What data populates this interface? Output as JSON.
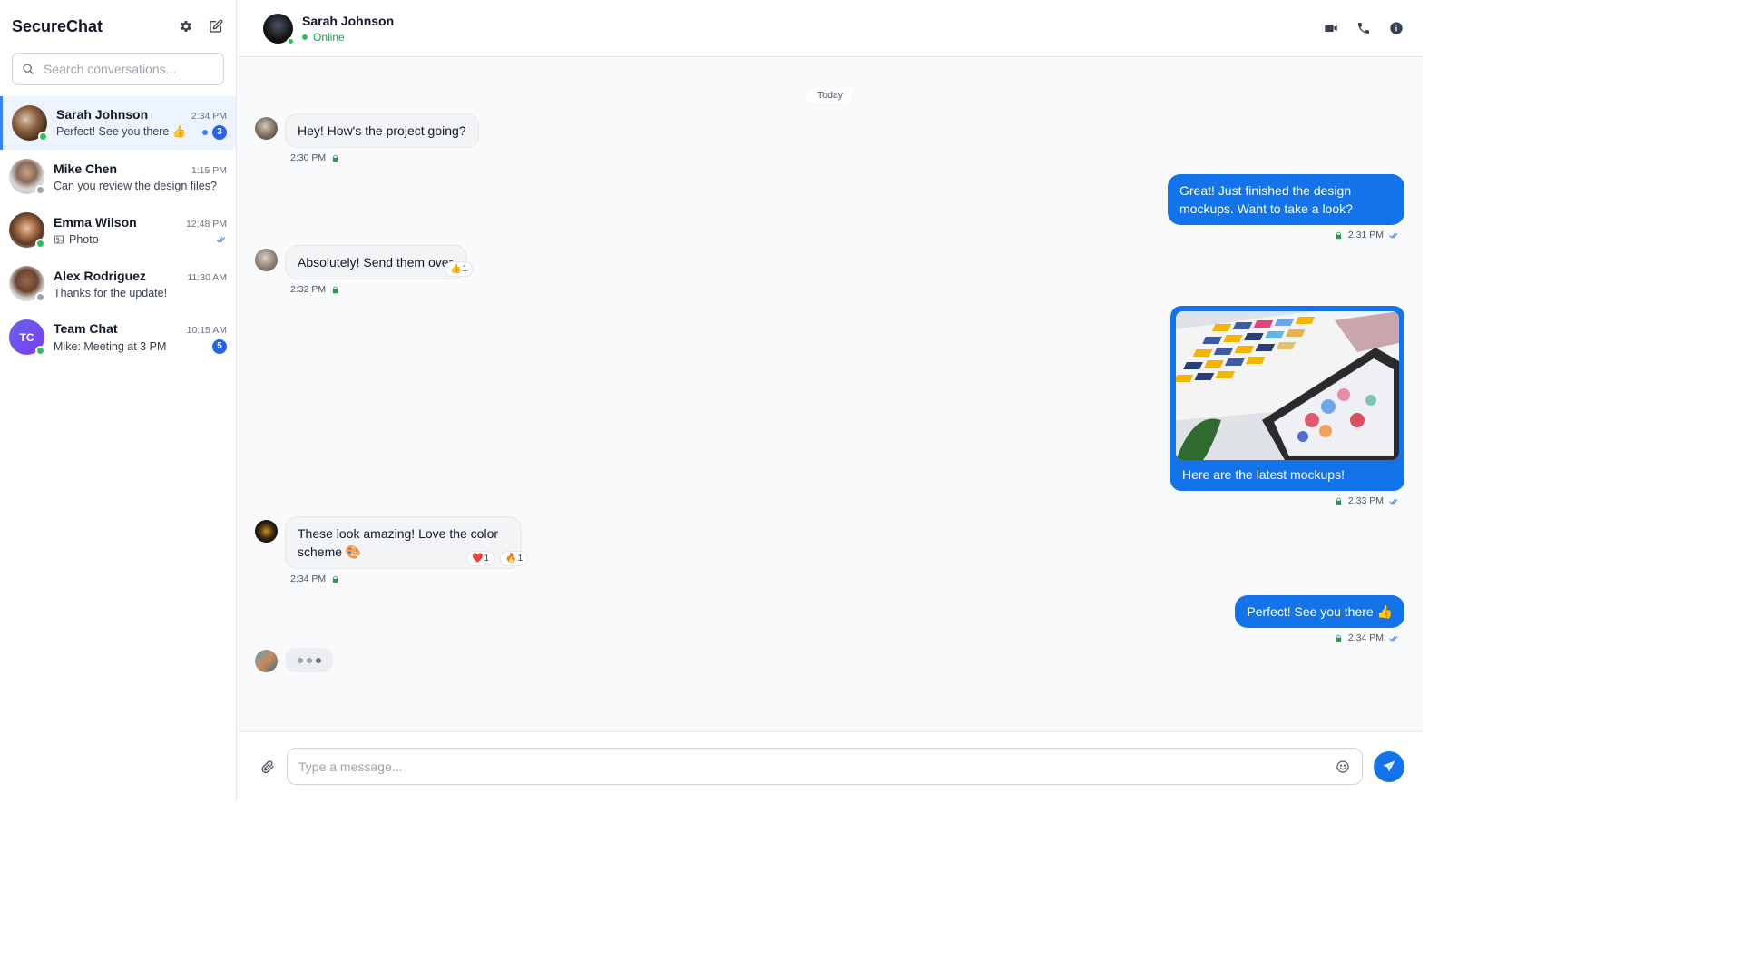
{
  "app": {
    "title": "SecureChat"
  },
  "search": {
    "placeholder": "Search conversations..."
  },
  "conversations": [
    {
      "name": "Sarah Johnson",
      "time": "2:34 PM",
      "preview": "Perfect! See you there 👍",
      "unread": "3",
      "status": "online"
    },
    {
      "name": "Mike Chen",
      "time": "1:15 PM",
      "preview": "Can you review the design files?",
      "status": "offline"
    },
    {
      "name": "Emma Wilson",
      "time": "12:48 PM",
      "preview": "Photo",
      "status": "online"
    },
    {
      "name": "Alex Rodriguez",
      "time": "11:30 AM",
      "preview": "Thanks for the update!",
      "status": "offline"
    },
    {
      "name": "Team Chat",
      "initials": "TC",
      "time": "10:15 AM",
      "preview": "Mike: Meeting at 3 PM",
      "unread": "5",
      "status": "online"
    }
  ],
  "chat": {
    "contact_name": "Sarah Johnson",
    "contact_status": "Online",
    "day_label": "Today"
  },
  "messages": [
    {
      "direction": "in",
      "text": "Hey! How's the project going?",
      "time": "2:30 PM"
    },
    {
      "direction": "out",
      "text": "Great! Just finished the design mockups. Want to take a look?",
      "time": "2:31 PM"
    },
    {
      "direction": "in",
      "text": "Absolutely! Send them over",
      "time": "2:32 PM",
      "reactions": [
        {
          "emoji": "👍",
          "count": "1"
        }
      ]
    },
    {
      "direction": "out",
      "type": "image",
      "caption": "Here are the latest mockups!",
      "time": "2:33 PM"
    },
    {
      "direction": "in",
      "text": "These look amazing! Love the color scheme 🎨",
      "time": "2:34 PM",
      "reactions": [
        {
          "emoji": "❤️",
          "count": "1"
        },
        {
          "emoji": "🔥",
          "count": "1"
        }
      ]
    },
    {
      "direction": "out",
      "text": "Perfect! See you there 👍",
      "time": "2:34 PM"
    }
  ],
  "composer": {
    "placeholder": "Type a message..."
  },
  "colors": {
    "accent": "#1273eb",
    "online": "#22c55e",
    "lock": "#16a34a"
  }
}
